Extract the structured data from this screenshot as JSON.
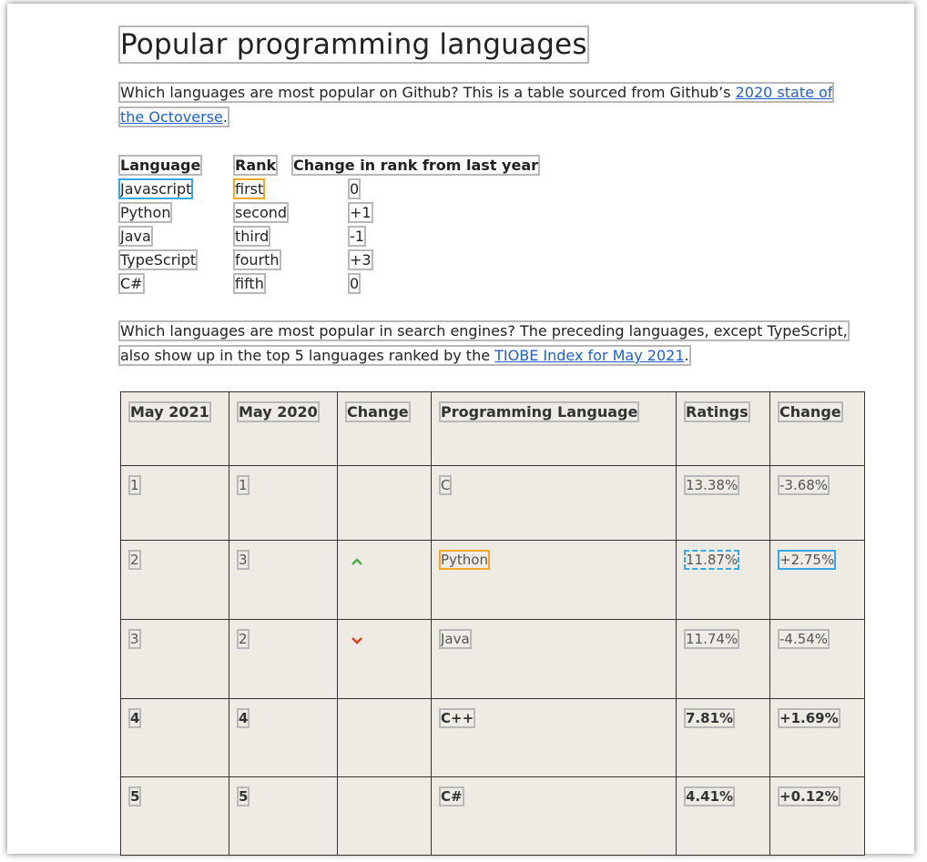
{
  "title": "Popular programming languages",
  "intro": {
    "text": "Which languages are most popular on Github? This is a table sourced from Github’s ",
    "link_text": "2020 state of the Octoverse",
    "end": "."
  },
  "github_table": {
    "headers": [
      "Language",
      "Rank",
      "Change in rank from last year"
    ],
    "rows": [
      [
        "Javascript",
        "first",
        "0"
      ],
      [
        "Python",
        "second",
        "+1"
      ],
      [
        "Java",
        "third",
        "-1"
      ],
      [
        "TypeScript",
        "fourth",
        "+3"
      ],
      [
        "C#",
        "fifth",
        "0"
      ]
    ]
  },
  "search": {
    "text": "Which languages are most popular in search engines? The preceding languages, except TypeScript,  also show up in the top 5 languages ranked by the ",
    "link_text": "TIOBE Index for May 2021",
    "end": "."
  },
  "tiobe_table": {
    "headers": [
      "May 2021",
      "May 2020",
      "Change",
      "Programming Language",
      "Ratings",
      "Change"
    ],
    "rows": [
      {
        "may2021": "1",
        "may2020": "1",
        "change_icon": "",
        "language": "C",
        "ratings": "13.38%",
        "change": "-3.68%"
      },
      {
        "may2021": "2",
        "may2020": "3",
        "change_icon": "chevron-up-icon",
        "language": "Python",
        "ratings": "11.87%",
        "change": "+2.75%"
      },
      {
        "may2021": "3",
        "may2020": "2",
        "change_icon": "chevron-down-icon",
        "language": "Java",
        "ratings": "11.74%",
        "change": "-4.54%"
      },
      {
        "may2021": "4",
        "may2020": "4",
        "change_icon": "",
        "language": "C++",
        "ratings": "7.81%",
        "change": "+1.69%"
      },
      {
        "may2021": "5",
        "may2020": "5",
        "change_icon": "",
        "language": "C#",
        "ratings": "4.41%",
        "change": "+0.12%"
      }
    ]
  },
  "colors": {
    "link": "#1f5fcf",
    "up": "#4caf50",
    "down": "#e0441b",
    "table_bg": "#eeebe4",
    "highlight_blue": "#33a7e8",
    "highlight_orange": "#f5a623"
  }
}
